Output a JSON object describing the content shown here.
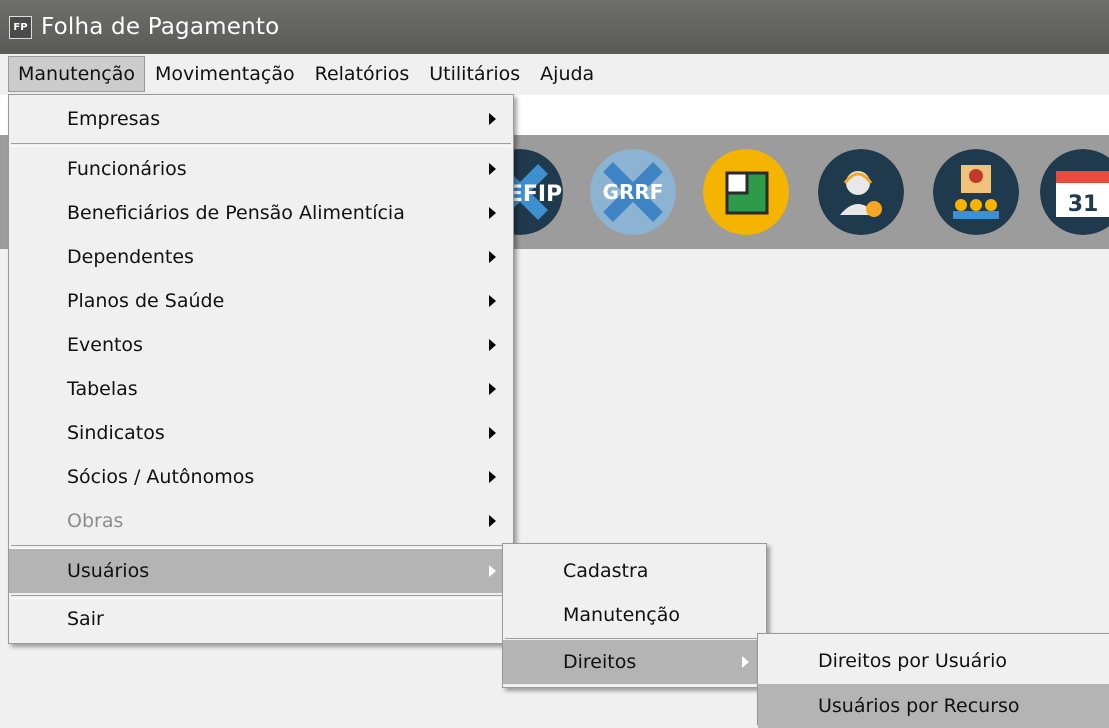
{
  "window": {
    "title": "Folha de Pagamento",
    "icon_text": "FP"
  },
  "menubar": [
    "Manutenção",
    "Movimentação",
    "Relatórios",
    "Utilitários",
    "Ajuda"
  ],
  "main_menu": {
    "items": [
      "Empresas",
      "Funcionários",
      "Beneficiários de Pensão Alimentícia",
      "Dependentes",
      "Planos de Saúde",
      "Eventos",
      "Tabelas",
      "Sindicatos",
      "Sócios / Autônomos",
      "Obras",
      "Usuários",
      "Sair"
    ]
  },
  "usuarios_menu": {
    "items": [
      "Cadastra",
      "Manutenção",
      "Direitos"
    ]
  },
  "direitos_menu": {
    "items": [
      "Direitos por Usuário",
      "Usuários por Recurso"
    ]
  },
  "toolbar": {
    "sefip_label": "EFIP",
    "grrf_label": "GRRF",
    "calendar_day": "31"
  }
}
